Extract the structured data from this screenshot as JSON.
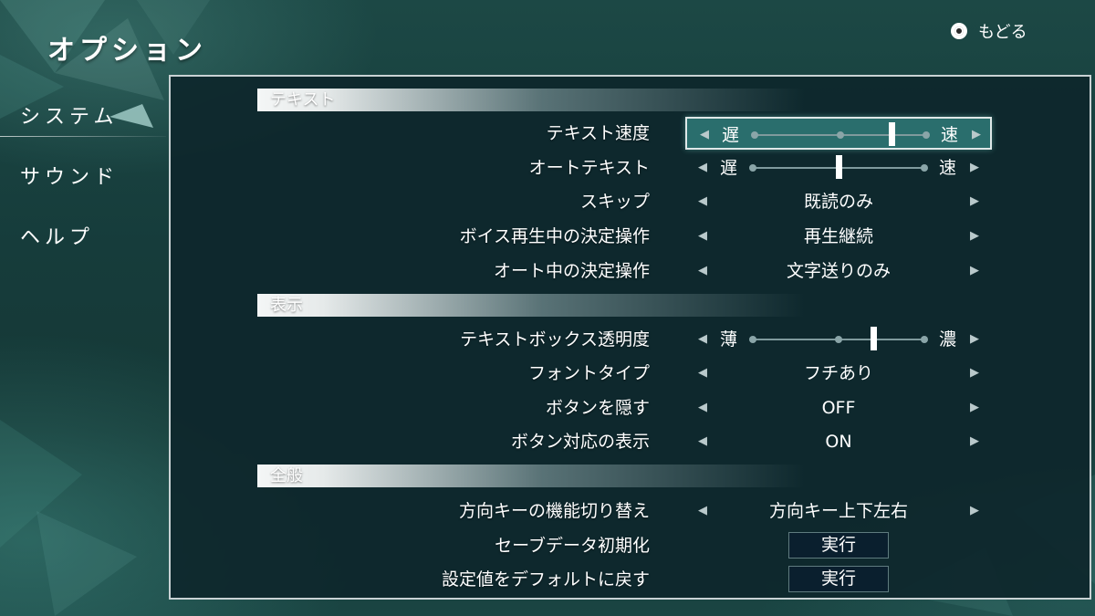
{
  "header": {
    "title": "オプション",
    "back_label": "もどる",
    "back_icon": "circle-button-icon"
  },
  "sidebar": {
    "items": [
      {
        "label": "システム",
        "active": true
      },
      {
        "label": "サウンド",
        "active": false
      },
      {
        "label": "ヘルプ",
        "active": false
      }
    ]
  },
  "sections": {
    "text": {
      "header": "テキスト",
      "rows": {
        "text_speed": {
          "label": "テキスト速度",
          "min_label": "遅",
          "max_label": "速",
          "level": 0.8,
          "selected": true
        },
        "auto_text": {
          "label": "オートテキスト",
          "min_label": "遅",
          "max_label": "速",
          "level": 0.5
        },
        "skip": {
          "label": "スキップ",
          "value": "既読のみ"
        },
        "voice_confirm": {
          "label": "ボイス再生中の決定操作",
          "value": "再生継続"
        },
        "auto_confirm": {
          "label": "オート中の決定操作",
          "value": "文字送りのみ"
        }
      }
    },
    "display": {
      "header": "表示",
      "rows": {
        "textbox_opacity": {
          "label": "テキストボックス透明度",
          "min_label": "薄",
          "max_label": "濃",
          "level": 0.7
        },
        "font_type": {
          "label": "フォントタイプ",
          "value": "フチあり"
        },
        "hide_buttons": {
          "label": "ボタンを隠す",
          "value": "OFF"
        },
        "button_hints": {
          "label": "ボタン対応の表示",
          "value": "ON"
        }
      }
    },
    "general": {
      "header": "全般",
      "rows": {
        "direction_keys": {
          "label": "方向キーの機能切り替え",
          "value": "方向キー上下左右"
        },
        "reset_save": {
          "label": "セーブデータ初期化",
          "button": "実行"
        },
        "reset_settings": {
          "label": "設定値をデフォルトに戻す",
          "button": "実行"
        }
      }
    }
  },
  "colors": {
    "background": "#163c3b",
    "panel": "#0e272c",
    "selected_row": "#2a6e6d",
    "arrow": "#b9c9cb"
  }
}
